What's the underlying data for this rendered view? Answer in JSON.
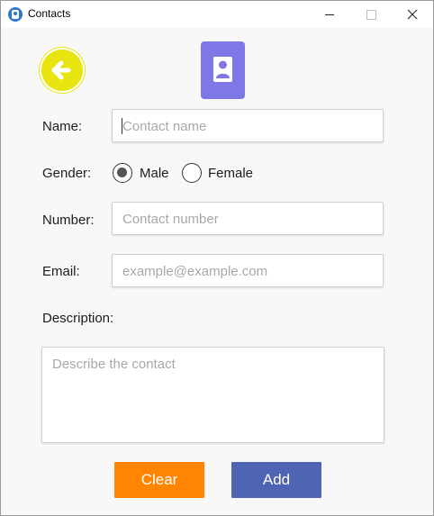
{
  "window": {
    "title": "Contacts",
    "controls": {
      "minimize": "—",
      "maximize": "□",
      "close": "✕"
    }
  },
  "header": {
    "back_icon": "back-arrow-icon",
    "avatar_icon": "contact-person-icon",
    "colors": {
      "back": "#e7e40f",
      "avatar": "#7f77e5"
    }
  },
  "form": {
    "name": {
      "label": "Name:",
      "placeholder": "Contact name",
      "value": ""
    },
    "gender": {
      "label": "Gender:",
      "options": [
        {
          "label": "Male",
          "checked": true
        },
        {
          "label": "Female",
          "checked": false
        }
      ]
    },
    "number": {
      "label": "Number:",
      "placeholder": "Contact number",
      "value": ""
    },
    "email": {
      "label": "Email:",
      "placeholder": "example@example.com",
      "value": ""
    },
    "description": {
      "label": "Description:",
      "placeholder": "Describe the contact",
      "value": ""
    }
  },
  "actions": {
    "clear_label": "Clear",
    "add_label": "Add",
    "colors": {
      "clear": "#ff8401",
      "add": "#4f64b3"
    }
  }
}
